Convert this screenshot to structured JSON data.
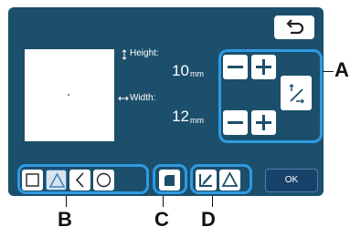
{
  "screen": {
    "height": {
      "label": "Height:",
      "value": "10",
      "unit": "mm"
    },
    "width": {
      "label": "Width:",
      "value": "12",
      "unit": "mm"
    },
    "ok_label": "OK"
  },
  "icons": {
    "back": "undo-arrow-icon",
    "height_arrow": "vertical-double-arrow-icon",
    "width_arrow": "horizontal-double-arrow-icon",
    "minus": "minus-icon",
    "plus": "plus-icon",
    "aspect": "aspect-ratio-lock-icon",
    "shapes": [
      "square-icon",
      "triangle-icon",
      "chevron-left-icon",
      "circle-icon"
    ],
    "corner": "rounded-corner-icon",
    "outline": "outline-icon",
    "triangle_outline": "triangle-outline-icon"
  },
  "callouts": {
    "a": "A",
    "b": "B",
    "c": "C",
    "d": "D"
  },
  "colors": {
    "screen": "#1c4f6b",
    "highlight": "#2f9ae3",
    "ok_button": "#17426a",
    "selected_icon": "#3f84c8"
  }
}
